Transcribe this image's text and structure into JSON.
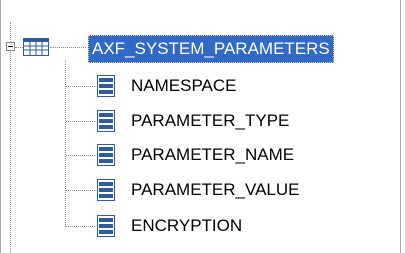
{
  "tree": {
    "root": {
      "label": "AXF_SYSTEM_PARAMETERS",
      "expanded": true,
      "selected": true,
      "icon": "table-icon"
    },
    "children": [
      {
        "label": "NAMESPACE",
        "icon": "column-icon"
      },
      {
        "label": "PARAMETER_TYPE",
        "icon": "column-icon"
      },
      {
        "label": "PARAMETER_NAME",
        "icon": "column-icon"
      },
      {
        "label": "PARAMETER_VALUE",
        "icon": "column-icon"
      },
      {
        "label": "ENCRYPTION",
        "icon": "column-icon"
      }
    ]
  },
  "colors": {
    "selection_bg": "#3169c6",
    "selection_text": "#ffffff",
    "focus_border": "#f7ce73",
    "icon_blue": "#2e5c9e"
  }
}
